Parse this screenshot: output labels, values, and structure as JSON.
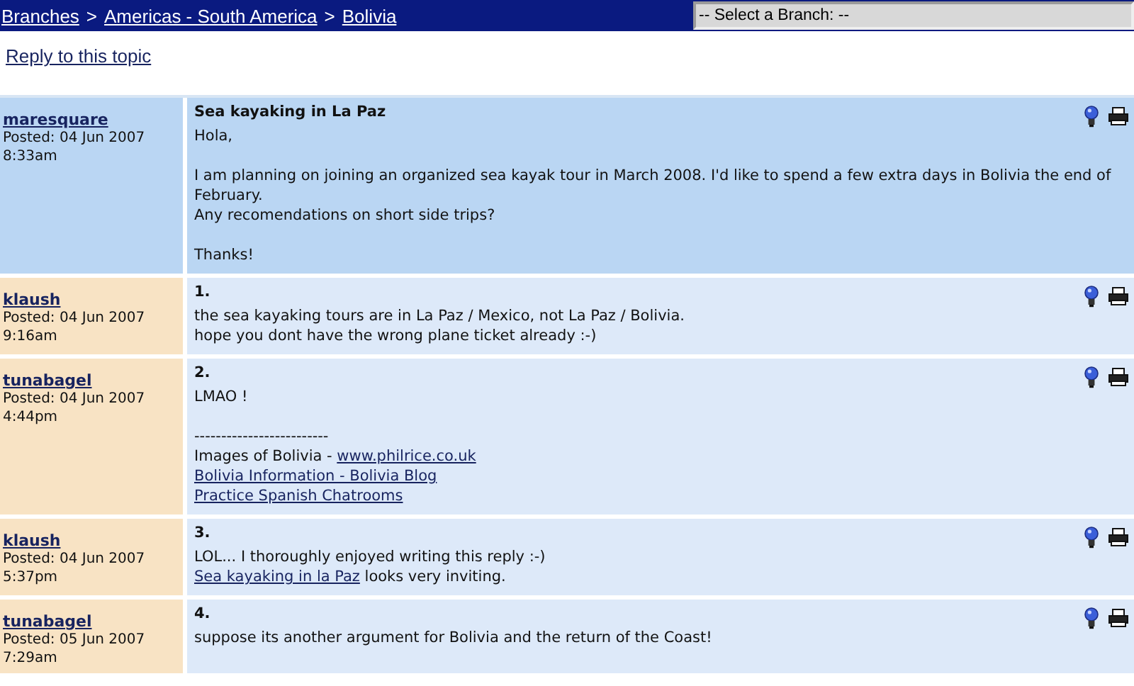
{
  "breadcrumb": [
    "Branches",
    "Americas - South America",
    "Bolivia"
  ],
  "breadcrumb_separator": ">",
  "branch_select": {
    "value": "-- Select a Branch: --"
  },
  "reply_link": "Reply to this topic",
  "posts": [
    {
      "kind": "topic",
      "author": "maresquare",
      "posted": "Posted: 04 Jun 2007",
      "time": "8:33am",
      "heading": "Sea kayaking in La Paz",
      "paragraphs": [
        [
          [
            {
              "kind": "text",
              "text": "Hola,"
            }
          ]
        ],
        [
          [
            {
              "kind": "text",
              "text": "I am planning on joining an organized sea kayak tour in March 2008. I'd like to spend a few extra days in Bolivia the end of February."
            }
          ],
          [
            {
              "kind": "text",
              "text": "Any recomendations on short side trips?"
            }
          ]
        ],
        [
          [
            {
              "kind": "text",
              "text": "Thanks!"
            }
          ]
        ]
      ]
    },
    {
      "kind": "reply",
      "author": "klaush",
      "posted": "Posted: 04 Jun 2007",
      "time": "9:16am",
      "heading": "1.",
      "paragraphs": [
        [
          [
            {
              "kind": "text",
              "text": "the sea kayaking tours are in La Paz / Mexico, not La Paz / Bolivia."
            }
          ],
          [
            {
              "kind": "text",
              "text": "hope you dont have the wrong plane ticket already :-)"
            }
          ]
        ]
      ]
    },
    {
      "kind": "reply",
      "author": "tunabagel",
      "posted": "Posted: 04 Jun 2007",
      "time": "4:44pm",
      "heading": "2.",
      "paragraphs": [
        [
          [
            {
              "kind": "text",
              "text": "LMAO !"
            }
          ]
        ],
        [
          [
            {
              "kind": "text",
              "text": "-------------------------"
            }
          ],
          [
            {
              "kind": "text",
              "text": "Images of Bolivia - "
            },
            {
              "kind": "link",
              "text": "www.philrice.co.uk"
            }
          ],
          [
            {
              "kind": "link",
              "text": "Bolivia Information - Bolivia Blog"
            }
          ],
          [
            {
              "kind": "link",
              "text": "Practice Spanish Chatrooms"
            }
          ]
        ]
      ]
    },
    {
      "kind": "reply",
      "author": "klaush",
      "posted": "Posted: 04 Jun 2007",
      "time": "5:37pm",
      "heading": "3.",
      "paragraphs": [
        [
          [
            {
              "kind": "text",
              "text": "LOL... I thoroughly enjoyed writing this reply :-)"
            }
          ],
          [
            {
              "kind": "link",
              "text": "Sea kayaking in la Paz"
            },
            {
              "kind": "text",
              "text": " looks very inviting."
            }
          ]
        ]
      ]
    },
    {
      "kind": "reply",
      "author": "tunabagel",
      "posted": "Posted: 05 Jun 2007",
      "time": "7:29am",
      "heading": "4.",
      "paragraphs": [
        [
          [
            {
              "kind": "text",
              "text": "suppose its another argument for Bolivia and the return of the Coast!"
            }
          ]
        ]
      ]
    }
  ]
}
